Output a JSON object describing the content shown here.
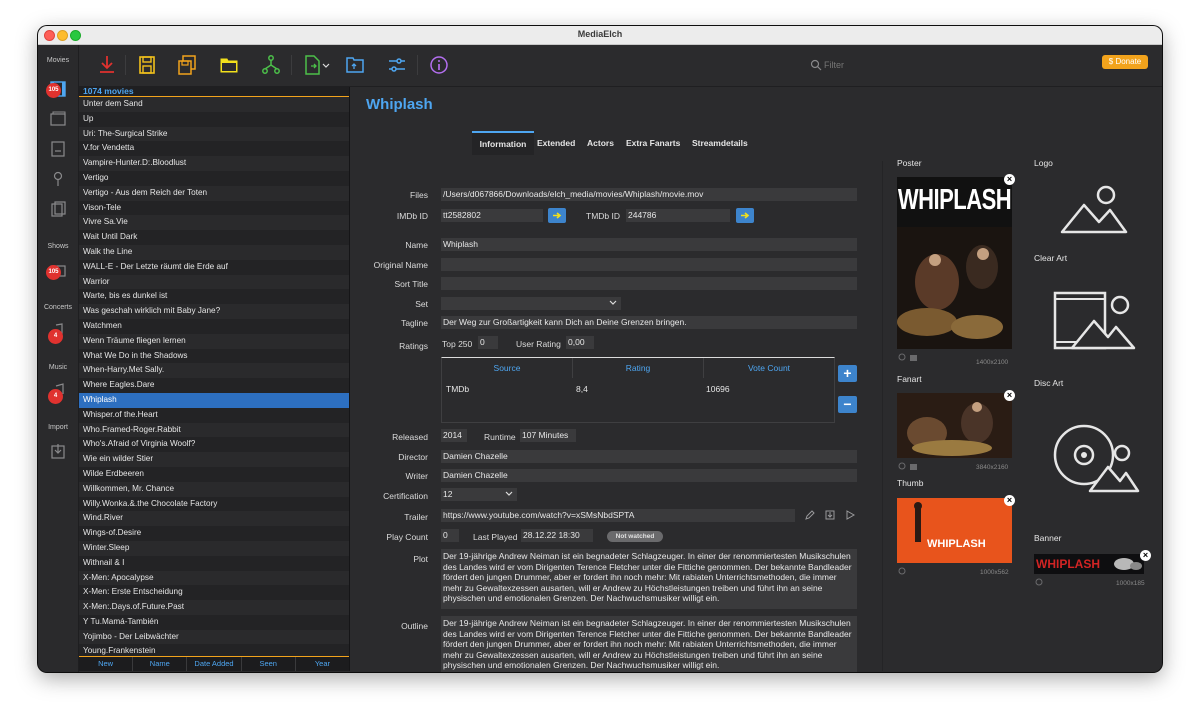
{
  "window": {
    "title": "MediaElch"
  },
  "sidebar": {
    "sections": [
      {
        "label": "Movies",
        "badge": "105"
      },
      {
        "label": "Shows",
        "badge": "105"
      },
      {
        "label": "Concerts",
        "badge": "4"
      },
      {
        "label": "Music",
        "badge": "4"
      },
      {
        "label": "Import"
      }
    ]
  },
  "toolbar": {
    "filter_placeholder": "Filter",
    "donate_label": "$ Donate",
    "icons": [
      "download-icon",
      "save-icon",
      "save-all-icon",
      "folder-icon",
      "sync-icon",
      "export-icon",
      "open-folder-icon",
      "settings-icon",
      "info-icon"
    ]
  },
  "movielist": {
    "count_label": "1074 movies",
    "items": [
      "Unter dem Sand",
      "Up",
      "Uri: The-Surgical Strike",
      "V.for Vendetta",
      "Vampire-Hunter.D:.Bloodlust",
      "Vertigo",
      "Vertigo - Aus dem Reich der Toten",
      "Vison-Tele",
      "Vivre Sa.Vie",
      "Wait Until Dark",
      "Walk the Line",
      "WALL-E - Der Letzte räumt die Erde auf",
      "Warrior",
      "Warte, bis es dunkel ist",
      "Was geschah wirklich mit Baby Jane?",
      "Watchmen",
      "Wenn Träume fliegen lernen",
      "What We Do in the Shadows",
      "When-Harry.Met Sally.",
      "Where Eagles.Dare",
      "Whiplash",
      "Whisper.of the.Heart",
      "Who.Framed-Roger.Rabbit",
      "Who's.Afraid of Virginia Woolf?",
      "Wie ein wilder Stier",
      "Wilde Erdbeeren",
      "Willkommen, Mr. Chance",
      "Willy.Wonka.&.the Chocolate Factory",
      "Wind.River",
      "Wings-of.Desire",
      "Winter.Sleep",
      "Withnail & I",
      "X-Men: Apocalypse",
      "X-Men: Erste Entscheidung",
      "X-Men:.Days.of.Future.Past",
      "Y Tu.Mamá-También",
      "Yojimbo - Der Leibwächter",
      "Young.Frankenstein"
    ],
    "selected_index": 20,
    "sort_buttons": [
      "New",
      "Name",
      "Date Added",
      "Seen",
      "Year"
    ]
  },
  "detail": {
    "title": "Whiplash",
    "tabs": [
      "Information",
      "Extended",
      "Actors",
      "Extra Fanarts",
      "Streamdetails"
    ],
    "labels": {
      "files": "Files",
      "imdb_id": "IMDb ID",
      "tmdb_id": "TMDb ID",
      "name": "Name",
      "original_name": "Original Name",
      "sort_title": "Sort Title",
      "set": "Set",
      "tagline": "Tagline",
      "ratings": "Ratings",
      "top250": "Top 250",
      "user_rating": "User Rating",
      "released": "Released",
      "runtime": "Runtime",
      "director": "Director",
      "writer": "Writer",
      "certification": "Certification",
      "trailer": "Trailer",
      "play_count": "Play Count",
      "last_played": "Last Played",
      "plot": "Plot",
      "outline": "Outline"
    },
    "files": "/Users/d067866/Downloads/elch_media/movies/Whiplash/movie.mov",
    "imdb_id": "tt2582802",
    "tmdb_id": "244786",
    "name": "Whiplash",
    "original_name": "",
    "sort_title": "",
    "set": "",
    "tagline": "Der Weg zur Großartigkeit kann Dich an Deine Grenzen bringen.",
    "top250": "0",
    "user_rating": "0,00",
    "ratings_table": {
      "headers": [
        "Source",
        "Rating",
        "Vote Count"
      ],
      "rows": [
        [
          "TMDb",
          "8,4",
          "10696"
        ]
      ]
    },
    "released": "2014",
    "runtime": "107 Minutes",
    "director": "Damien Chazelle",
    "writer": "Damien Chazelle",
    "certification": "12",
    "trailer": "https://www.youtube.com/watch?v=xSMsNbdSPTA",
    "play_count": "0",
    "last_played": "28.12.22 18:30",
    "watched_badge": "Not watched",
    "plot": "Der 19-jährige Andrew Neiman ist ein begnadeter Schlagzeuger. In einer der renommiertesten Musikschulen des Landes wird er vom Dirigenten Terence Fletcher unter die Fittiche genommen. Der bekannte Bandleader fördert den jungen Drummer, aber er fordert ihn noch mehr: Mit rabiaten Unterrichtsmethoden, die immer mehr zu Gewaltexzessen ausarten, will er Andrew zu Höchstleistungen treiben und führt ihn an seine physischen und emotionalen Grenzen. Der Nachwuchsmusiker willigt ein.",
    "outline": "Der 19-jährige Andrew Neiman ist ein begnadeter Schlagzeuger. In einer der renommiertesten Musikschulen des Landes wird er vom Dirigenten Terence Fletcher unter die Fittiche genommen. Der bekannte Bandleader fördert den jungen Drummer, aber er fordert ihn noch mehr: Mit rabiaten Unterrichtsmethoden, die immer mehr zu Gewaltexzessen ausarten, will er Andrew zu Höchstleistungen treiben und führt ihn an seine physischen und emotionalen Grenzen. Der Nachwuchsmusiker willigt ein."
  },
  "artwork": {
    "poster": {
      "label": "Poster",
      "text": "WHIPLASH",
      "resolution": "1400x2100"
    },
    "fanart": {
      "label": "Fanart",
      "resolution": "3840x2160"
    },
    "thumb": {
      "label": "Thumb",
      "text": "WHIPLASH",
      "resolution": "1000x562"
    },
    "logo": {
      "label": "Logo"
    },
    "clear_art": {
      "label": "Clear Art"
    },
    "disc_art": {
      "label": "Disc Art"
    },
    "banner": {
      "label": "Banner",
      "text": "WHIPLASH",
      "resolution": "1000x185"
    }
  },
  "colors": {
    "accent": "#4ea6f1",
    "selection": "#2d6fc0",
    "donate": "#f2a31c",
    "toolbar_red": "#e0322f",
    "toolbar_yellow": "#f2c11c",
    "toolbar_green": "#4cc04a",
    "toolbar_blue": "#4ea6f1",
    "toolbar_purple": "#b46ff0"
  }
}
